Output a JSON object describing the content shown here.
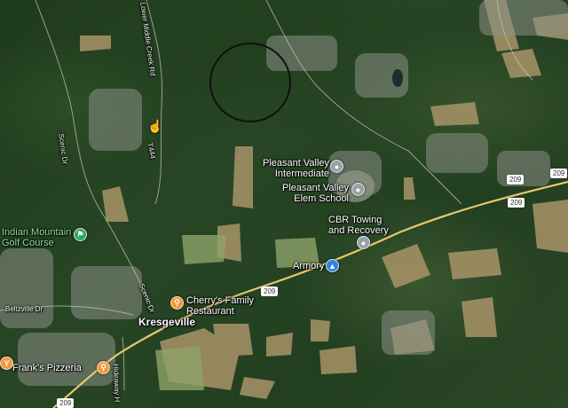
{
  "map": {
    "places": {
      "pleasant_valley_intermediate": "Pleasant Valley\nIntermediate",
      "pleasant_valley_elem": "Pleasant Valley\nElem School",
      "cbr_towing": "CBR Towing\nand Recovery",
      "armory": "Armory",
      "indian_mountain": "Indian Mountain\nGolf Course",
      "cherrys": "Cherry's Family\nRestaurant",
      "franks": "Frank's Pizzeria",
      "kresgeville": "Kresgeville"
    },
    "roads": {
      "middle_creek": "Lower Middle Creek Rd",
      "scenic_dr_1": "Scenic Dr",
      "scenic_dr_2": "Scenic Dr",
      "beltzville": "Beltzville Dr",
      "hidaway": "Hideaway H",
      "t444": "T444"
    },
    "shields": {
      "us209_a": "209",
      "us209_b": "209",
      "us209_c": "209",
      "us209_d": "209",
      "us209_e": "209"
    },
    "icons": {
      "school_1": "school-icon",
      "school_2": "school-icon",
      "towing": "place-pin-icon",
      "armory": "armory-icon",
      "golf": "golf-icon",
      "restaurant_cherry": "restaurant-icon",
      "restaurant_franks": "restaurant-icon",
      "bar": "bar-icon"
    },
    "colors": {
      "road_highway": "#e8c770",
      "forest": "#244020",
      "field": "#bba376",
      "label": "#ffffff",
      "golf_label": "#8fe0a0"
    }
  }
}
